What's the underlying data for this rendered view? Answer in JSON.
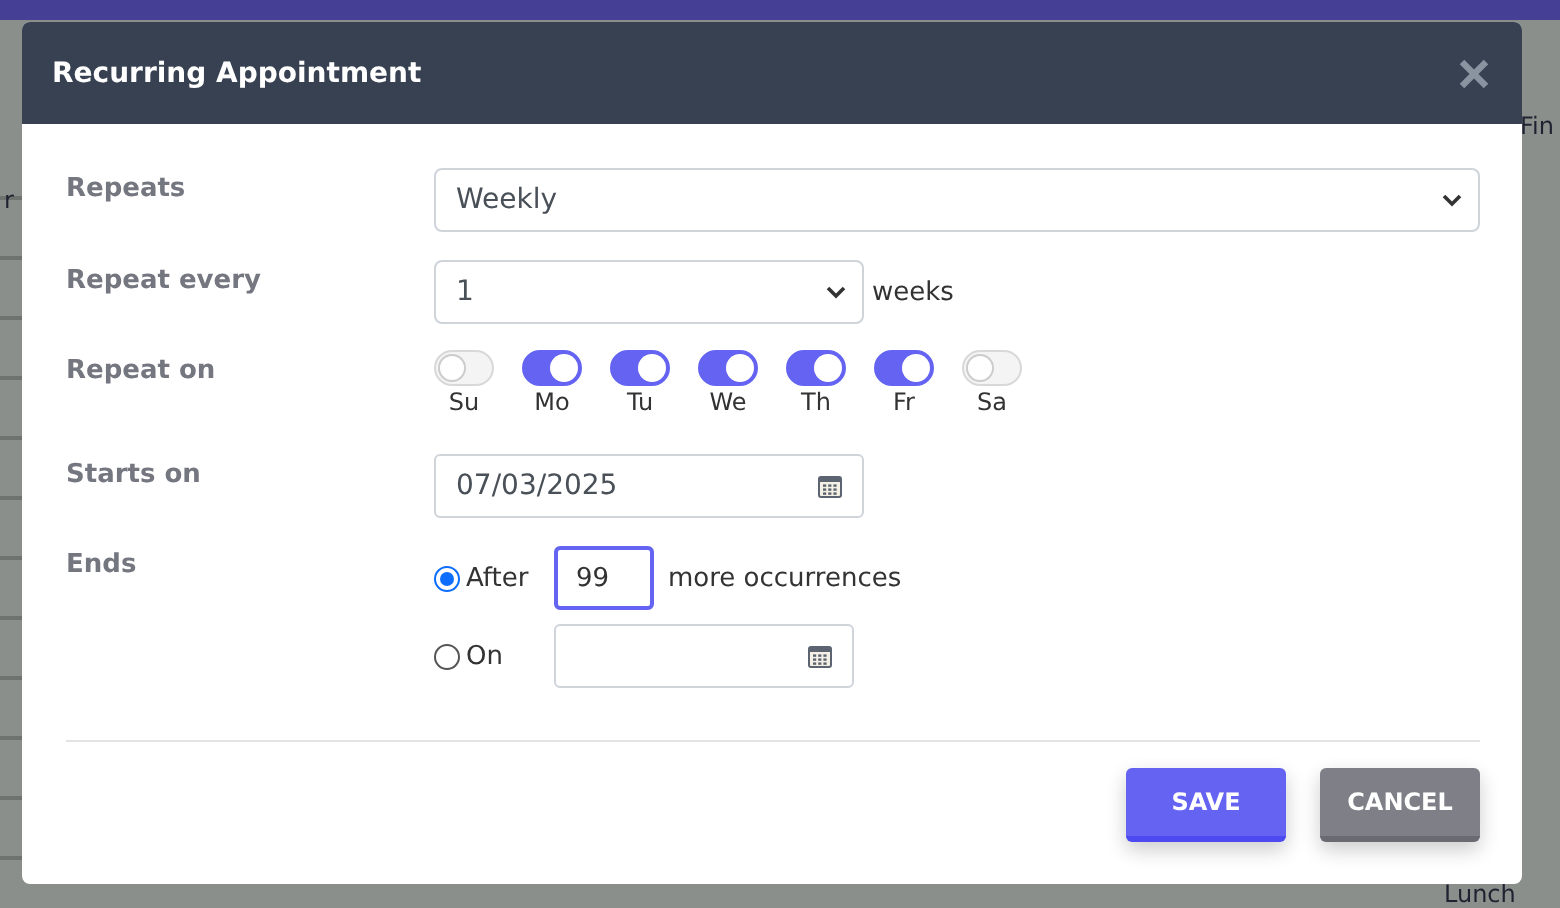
{
  "background": {
    "left_fragment": "r",
    "right_fragment": "Fin",
    "event_fragment": "Lunch"
  },
  "dialog": {
    "title": "Recurring Appointment",
    "repeats": {
      "label": "Repeats",
      "value": "Weekly"
    },
    "repeat_every": {
      "label": "Repeat every",
      "value": "1",
      "unit": "weeks"
    },
    "repeat_on": {
      "label": "Repeat on",
      "days": [
        {
          "label": "Su",
          "on": false
        },
        {
          "label": "Mo",
          "on": true
        },
        {
          "label": "Tu",
          "on": true
        },
        {
          "label": "We",
          "on": true
        },
        {
          "label": "Th",
          "on": true
        },
        {
          "label": "Fr",
          "on": true
        },
        {
          "label": "Sa",
          "on": false
        }
      ]
    },
    "starts_on": {
      "label": "Starts on",
      "value": "07/03/2025"
    },
    "ends": {
      "label": "Ends",
      "options": [
        {
          "kind": "count",
          "label": "After",
          "selected": true,
          "value": "99",
          "suffix": "more occurrences"
        },
        {
          "kind": "date",
          "label": "On",
          "selected": false
        }
      ]
    },
    "buttons": [
      {
        "kind": "primary",
        "label": "SAVE"
      },
      {
        "kind": "secondary",
        "label": "CANCEL"
      }
    ]
  }
}
